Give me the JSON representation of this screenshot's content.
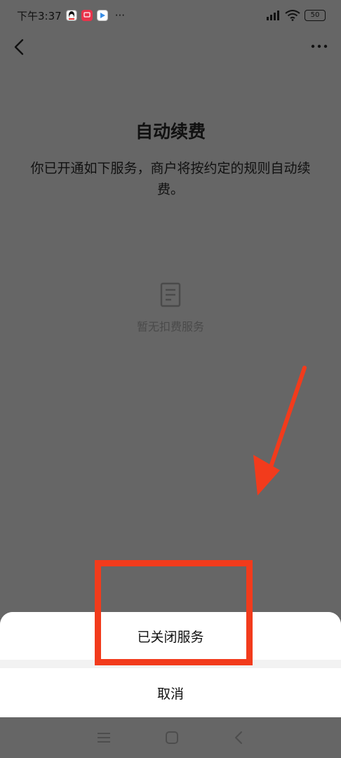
{
  "status_bar": {
    "time": "下午3:37",
    "more": "···",
    "battery": "50",
    "app_icons": [
      "qq-icon",
      "red-app-icon",
      "play-app-icon"
    ]
  },
  "main": {
    "title": "自动续费",
    "description": "你已开通如下服务，商户将按约定的规则自动续费。",
    "empty_text": "暂无扣费服务"
  },
  "sheet": {
    "closed_service_label": "已关闭服务",
    "cancel_label": "取消"
  },
  "colors": {
    "overlay": "#666666",
    "annotation": "#f23b1c",
    "sheet": "#ffffff"
  }
}
